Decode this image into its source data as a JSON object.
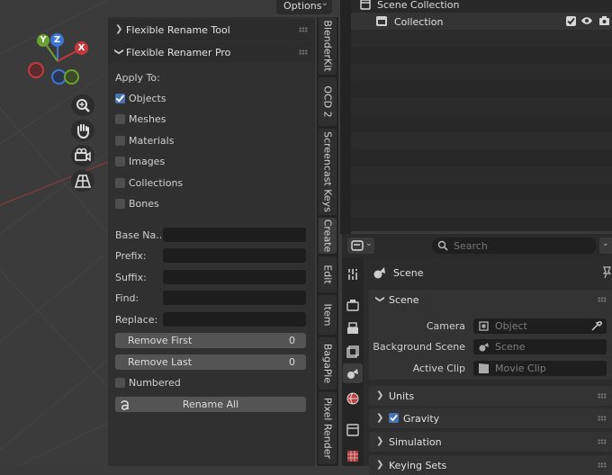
{
  "viewport": {
    "options_label": "Options",
    "gizmo": {
      "x": "X",
      "y": "Y",
      "z": "Z"
    },
    "colors": {
      "x_axis": "#c8383f",
      "y_axis": "#6ba131",
      "z_axis": "#3d76d8",
      "red_line": "#8a3a3a"
    }
  },
  "npanel": {
    "panel1_title": "Flexible Rename Tool",
    "panel2_title": "Flexible Renamer Pro",
    "apply_to_label": "Apply To:",
    "checkboxes": [
      {
        "label": "Objects",
        "checked": true
      },
      {
        "label": "Meshes",
        "checked": false
      },
      {
        "label": "Materials",
        "checked": false
      },
      {
        "label": "Images",
        "checked": false
      },
      {
        "label": "Collections",
        "checked": false
      },
      {
        "label": "Bones",
        "checked": false
      }
    ],
    "fields": [
      {
        "label": "Base Na...",
        "value": ""
      },
      {
        "label": "Prefix:",
        "value": ""
      },
      {
        "label": "Suffix:",
        "value": ""
      },
      {
        "label": "Find:",
        "value": ""
      },
      {
        "label": "Replace:",
        "value": ""
      }
    ],
    "remove_first": {
      "label": "Remove First",
      "value": "0"
    },
    "remove_last": {
      "label": "Remove Last",
      "value": "0"
    },
    "numbered": {
      "label": "Numbered",
      "checked": false
    },
    "rename_all_label": "Rename All"
  },
  "tabs": [
    "BlenderKit",
    "OCD 2",
    "Screencast Keys",
    "Create",
    "Edit",
    "Item",
    "BagaPie",
    "Pixel Render"
  ],
  "outliner": {
    "scene_collection": "Scene Collection",
    "collection": "Collection"
  },
  "properties": {
    "search_placeholder": "Search",
    "context_title": "Scene",
    "scene_section": "Scene",
    "camera_label": "Camera",
    "camera_placeholder": "Object",
    "background_scene_label": "Background Scene",
    "background_scene_placeholder": "Scene",
    "active_clip_label": "Active Clip",
    "active_clip_placeholder": "Movie Clip",
    "sections": [
      "Units",
      "Gravity",
      "Simulation",
      "Keying Sets"
    ],
    "gravity_checked": true
  }
}
